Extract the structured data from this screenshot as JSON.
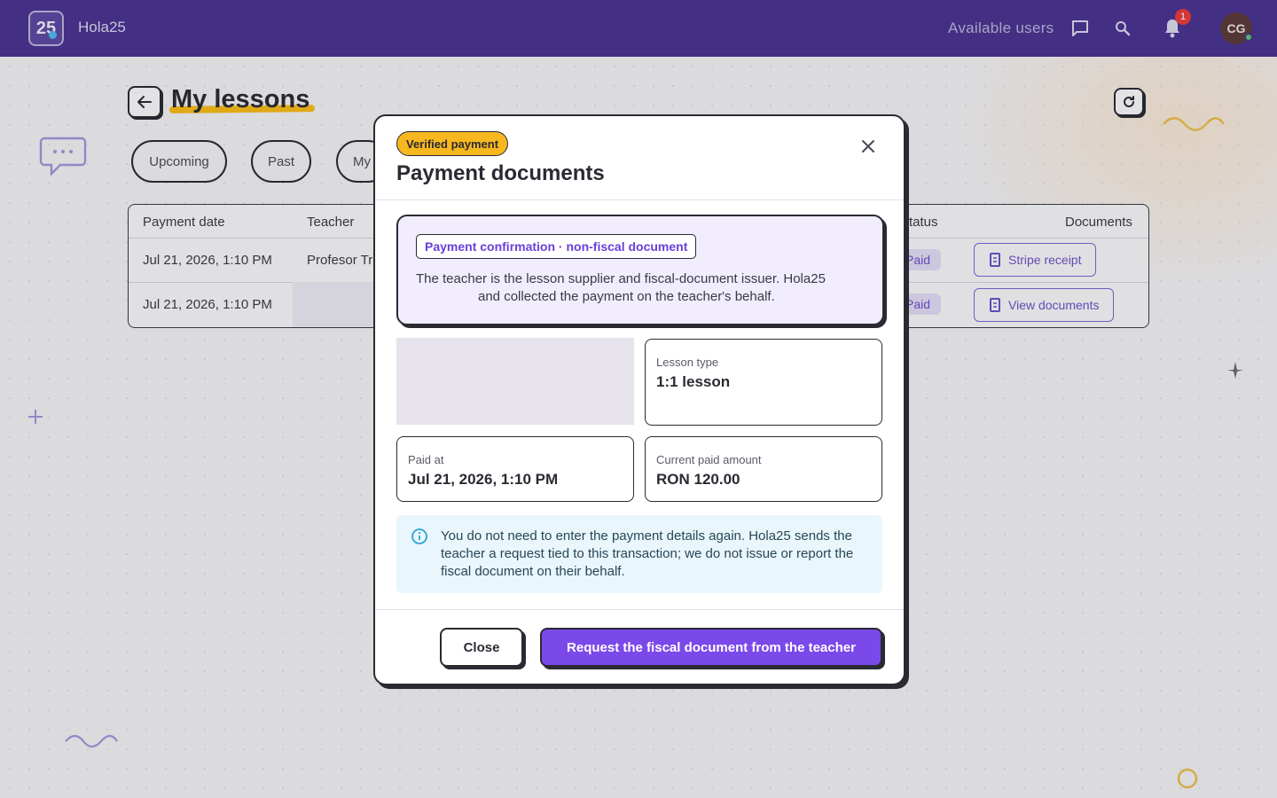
{
  "colors": {
    "topbar": "#49338f",
    "accent": "#7b48ea",
    "highlight": "#f2b617",
    "verified_badge": "#f7b71e",
    "notification_badge": "#e43b3b"
  },
  "topbar": {
    "logo_text": "25",
    "brand": "Hola25",
    "available_users": "Available users",
    "notification_count": "1",
    "avatar_initials": "CG",
    "icons": [
      "chat-icon",
      "search-icon",
      "bell-icon"
    ]
  },
  "page": {
    "title": "My lessons",
    "tabs": [
      "Upcoming",
      "Past",
      "My"
    ],
    "table": {
      "headers": {
        "payment_date": "Payment date",
        "teacher": "Teacher",
        "status": "tatus",
        "documents": "Documents"
      },
      "rows": [
        {
          "payment_date": "Jul 21, 2026, 1:10 PM",
          "teacher": "Profesor Tr",
          "status": "Paid",
          "document_action": "Stripe receipt"
        },
        {
          "payment_date": "Jul 21, 2026, 1:10 PM",
          "teacher": "",
          "status": "Paid",
          "document_action": "View documents"
        }
      ]
    }
  },
  "modal": {
    "badge": "Verified payment",
    "title": "Payment documents",
    "confirmation_tag": "Payment confirmation · non-fiscal document",
    "confirmation_text_line1": "The teacher is the lesson supplier and fiscal-document issuer. Hola25",
    "confirmation_text_line2": "and collected the payment on the teacher's behalf.",
    "lesson_type_label": "Lesson type",
    "lesson_type_value": "1:1 lesson",
    "paid_at_label": "Paid at",
    "paid_at_value": "Jul 21, 2026, 1:10 PM",
    "amount_label": "Current paid amount",
    "amount_value": "RON 120.00",
    "notice": "You do not need to enter the payment details again. Hola25 sends the teacher a request tied to this transaction; we do not issue or report the fiscal document on their behalf.",
    "close_button": "Close",
    "request_button": "Request the fiscal document from the teacher"
  }
}
